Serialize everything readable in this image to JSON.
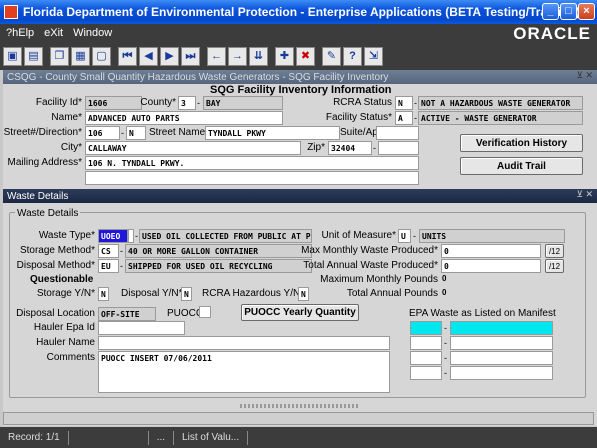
{
  "window": {
    "title": "Florida Department of Environmental Protection - Enterprise Applications (BETA Testing/Training)",
    "buttons": {
      "minimize": "_",
      "maximize": "□",
      "close": "×"
    }
  },
  "menu": {
    "help": "?hElp",
    "exit": "eXit",
    "window": "Window"
  },
  "brand": "ORACLE",
  "toolbar_icons": [
    "save-icon",
    "print-icon",
    "copy-icon",
    "paste-icon",
    "clear-icon",
    "first-record-icon",
    "previous-record-icon",
    "next-record-icon",
    "last-record-icon",
    "previous-block-icon",
    "next-block-icon",
    "enter-query-icon",
    "insert-record-icon",
    "delete-record-icon",
    "edit-icon",
    "help-icon",
    "exit-icon"
  ],
  "facility_window": {
    "title": "CSQG - County Small Quantity Hazardous Waste Generators - SQG Facility Inventory",
    "heading": "SQG Facility Inventory Information",
    "facility_id_label": "Facility Id*",
    "facility_id": "1606",
    "county_label": "County*",
    "county_code": "3",
    "county_name": "BAY",
    "rcra_status_label": "RCRA Status",
    "rcra_code": "N",
    "rcra_desc": "NOT A HAZARDOUS WASTE GENERATOR",
    "name_label": "Name*",
    "name": "ADVANCED AUTO PARTS",
    "facility_status_label": "Facility Status*",
    "status_code": "A",
    "status_desc": "ACTIVE - WASTE GENERATOR",
    "street_no_label": "Street#/Direction*",
    "street_no": "106",
    "direction": "N",
    "street_name_label": "Street Name*",
    "street_name": "TYNDALL PKWY",
    "suite_label": "Suite/Apt#",
    "suite": "",
    "city_label": "City*",
    "city": "CALLAWAY",
    "zip_label": "Zip*",
    "zip": "32404",
    "zip_ext": "",
    "mailing_label": "Mailing Address*",
    "mailing_1": "106 N. TYNDALL PKWY.",
    "verification_button": "Verification History",
    "audit_button": "Audit Trail"
  },
  "waste_window": {
    "title": "Waste Details",
    "group_label": "Waste Details",
    "waste_type_label": "Waste Type*",
    "waste_code": "UOEO",
    "waste_desc": "USED OIL COLLECTED FROM PUBLIC AT PUC",
    "uom_label": "Unit of Measure*",
    "uom_code": "U",
    "uom_desc": "UNITS",
    "storage_method_label": "Storage Method*",
    "storage_code": "CS",
    "storage_desc": "40 OR MORE GALLON CONTAINER",
    "max_monthly_label": "Max Monthly Waste Produced*",
    "max_monthly": "0",
    "max_monthly_unit": "/12",
    "disposal_method_label": "Disposal Method*",
    "disposal_code": "EU",
    "disposal_desc": "SHIPPED FOR USED OIL RECYCLING",
    "total_annual_label": "Total Annual Waste Produced*",
    "total_annual": "0",
    "total_annual_unit": "/12",
    "questionable_label": "Questionable",
    "max_monthly_pounds_label": "Maximum Monthly Pounds",
    "max_monthly_pounds": "0",
    "storage_yn_label": "Storage Y/N*",
    "storage_yn": "N",
    "disposal_yn_label": "Disposal Y/N*",
    "disposal_yn": "N",
    "rcra_haz_label": "RCRA Hazardous Y/N*",
    "rcra_haz": "N",
    "total_annual_pounds_label": "Total Annual Pounds",
    "total_annual_pounds": "0",
    "disposal_location_label": "Disposal Location",
    "disposal_location": "OFF-SITE",
    "puocc_label": "PUOCC",
    "puocc_button": "PUOCC Yearly Quantity",
    "epa_label": "EPA Waste as Listed on Manifest",
    "hauler_epa_label": "Hauler Epa Id",
    "hauler_epa": "",
    "hauler_name_label": "Hauler Name",
    "hauler_name": "",
    "comments_label": "Comments",
    "comments": "PUOCC INSERT 07/06/2011"
  },
  "status": {
    "record": "Record: 1/1",
    "dots": "...",
    "list": "List of Valu..."
  }
}
